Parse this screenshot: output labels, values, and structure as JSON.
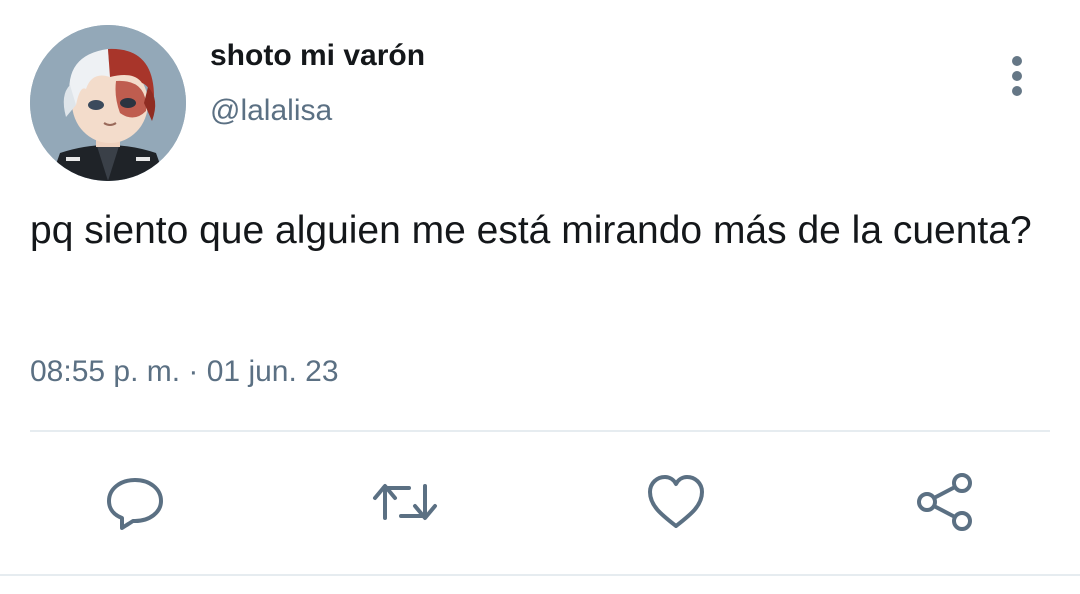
{
  "user": {
    "display_name": "shoto mi varón",
    "handle": "@lalalisa",
    "avatar_icon": "anime-character-avatar"
  },
  "tweet": {
    "text": "pq siento que alguien me está mirando más de la cuenta?",
    "timestamp": "08:55 p. m. · 01 jun. 23"
  },
  "actions": [
    {
      "name": "reply",
      "icon": "comment-bubble-icon"
    },
    {
      "name": "retweet",
      "icon": "retweet-icon"
    },
    {
      "name": "like",
      "icon": "heart-icon"
    },
    {
      "name": "share",
      "icon": "share-icon"
    }
  ],
  "colors": {
    "text_primary": "#14171a",
    "text_secondary": "#5b7083",
    "icon": "#5b7083",
    "divider": "#e6ecf0"
  }
}
